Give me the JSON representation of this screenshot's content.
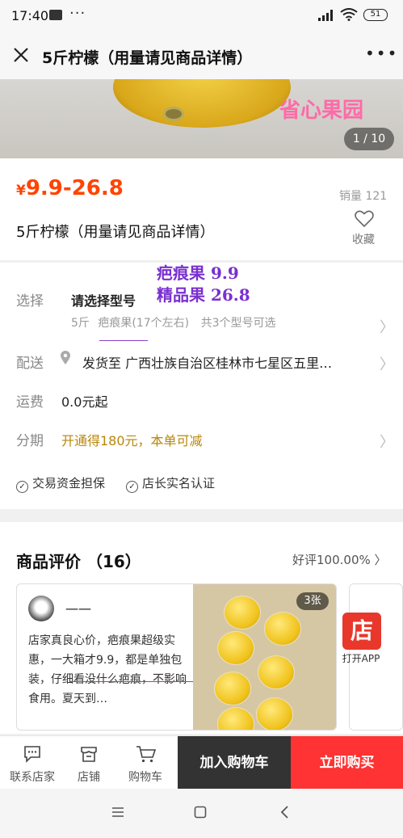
{
  "status": {
    "time": "17:40",
    "battery": "51"
  },
  "header": {
    "title": "5斤柠檬（用量请见商品详情）"
  },
  "gallery": {
    "watermark": "省心果园",
    "pager": "1 / 10"
  },
  "product": {
    "price_symbol": "¥",
    "price_range": "9.9-26.8",
    "sales": "销量 121",
    "title": "5斤柠檬（用量请见商品详情）",
    "favorite_label": "收藏"
  },
  "handwritten_note": [
    "疤痕果 9.9",
    "精品果 26.8"
  ],
  "options": {
    "select_label": "选择",
    "select_value": "请选择型号",
    "chip_weight": "5斤",
    "chip_grade": "疤痕果(17个左右)",
    "chip_total": "共3个型号可选",
    "ship_label": "配送",
    "ship_value": "发货至  广西壮族自治区桂林市七星区五里…",
    "fee_label": "运费",
    "fee_value": "0.0元起",
    "install_label": "分期",
    "install_value": "开通得180元，本单可减",
    "install_color": "#b8860b",
    "assurance": [
      "交易资金担保",
      "店长实名认证"
    ]
  },
  "reviews": {
    "heading": "商品评价 （16）",
    "good_rate": "好评100.00%",
    "user": "一一",
    "text": "店家真良心价，疤痕果超级实惠，一大箱才9.9，都是单独包装，仔细看没什么疤痕，不影响食用。夏天到…",
    "photo_count": "3张",
    "app_logo": "店",
    "app_label": "打开APP"
  },
  "bottom": {
    "contact_label": "联系店家",
    "store_label": "店铺",
    "cart_label": "购物车",
    "add_cart": "加入购物车",
    "buy_now": "立即购买"
  },
  "colors": {
    "price": "#ff4400",
    "buy": "#ff3333",
    "cart_button": "#333333",
    "note": "#7a2fd0"
  },
  "icons": [
    "close-icon",
    "more-icon",
    "heart-icon",
    "location-pin-icon",
    "chevron-right-icon",
    "check-circle-icon",
    "chat-icon",
    "store-icon",
    "cart-icon",
    "menu-icon",
    "home-icon",
    "back-icon"
  ]
}
